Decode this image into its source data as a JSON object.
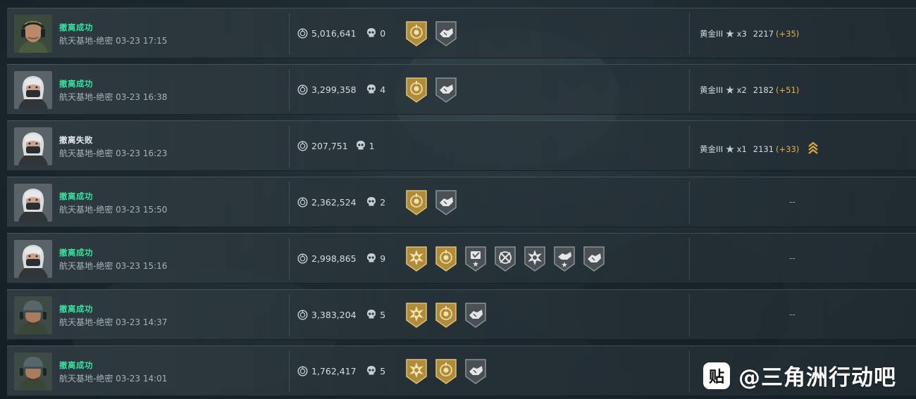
{
  "colors": {
    "success": "#38e2a0",
    "fail": "#e6eaec",
    "score_delta": "#e3b24a",
    "gold_badge": "#b08c3a",
    "grey_badge": "#4a5054"
  },
  "rows": [
    {
      "status": "撤离成功",
      "status_type": "success",
      "map": "航天基地-绝密",
      "time": "03-23 17:15",
      "avatar": "male-operator-headset",
      "money": "5,016,641",
      "kills": "0",
      "badges": [
        "gold-shield-badge",
        "grey-handshake-badge"
      ],
      "rank": "黄金III",
      "stars": "x3",
      "score": "2217",
      "delta": "(+35)",
      "chevrons": false
    },
    {
      "status": "撤离成功",
      "status_type": "success",
      "map": "航天基地-绝密",
      "time": "03-23 16:38",
      "avatar": "female-operator-masked",
      "money": "3,299,358",
      "kills": "4",
      "badges": [
        "gold-shield-badge",
        "grey-handshake-badge"
      ],
      "rank": "黄金III",
      "stars": "x2",
      "score": "2182",
      "delta": "(+51)",
      "chevrons": false
    },
    {
      "status": "撤离失败",
      "status_type": "fail",
      "map": "航天基地-绝密",
      "time": "03-23 16:23",
      "avatar": "female-operator-masked",
      "money": "207,751",
      "kills": "1",
      "badges": [],
      "rank": "黄金III",
      "stars": "x1",
      "score": "2131",
      "delta": "(+33)",
      "chevrons": true
    },
    {
      "status": "撤离成功",
      "status_type": "success",
      "map": "航天基地-绝密",
      "time": "03-23 15:50",
      "avatar": "female-operator-masked",
      "money": "2,362,524",
      "kills": "2",
      "badges": [
        "gold-shield-badge",
        "grey-handshake-badge"
      ],
      "dash": "--"
    },
    {
      "status": "撤离成功",
      "status_type": "success",
      "map": "航天基地-绝密",
      "time": "03-23 15:16",
      "avatar": "female-operator-masked",
      "money": "2,998,865",
      "kills": "9",
      "badges": [
        "gold-burst-badge",
        "gold-shield-badge",
        "grey-heart-star-badge",
        "grey-crossed-arrows-badge",
        "grey-burst-badge",
        "grey-handshake-star-badge",
        "grey-handshake-badge"
      ],
      "dash": "--"
    },
    {
      "status": "撤离成功",
      "status_type": "success",
      "map": "航天基地-绝密",
      "time": "03-23 14:37",
      "avatar": "male-operator-cap",
      "money": "3,383,204",
      "kills": "5",
      "badges": [
        "gold-burst-badge",
        "gold-shield-badge",
        "grey-handshake-badge"
      ],
      "dash": "--"
    },
    {
      "status": "撤离成功",
      "status_type": "success",
      "map": "航天基地-绝密",
      "time": "03-23 14:01",
      "avatar": "male-operator-cap",
      "money": "1,762,417",
      "kills": "5",
      "badges": [
        "gold-burst-badge",
        "gold-shield-badge",
        "grey-handshake-badge"
      ]
    }
  ],
  "watermark": {
    "logo_glyph": "贴",
    "text": "@三角洲行动吧"
  }
}
